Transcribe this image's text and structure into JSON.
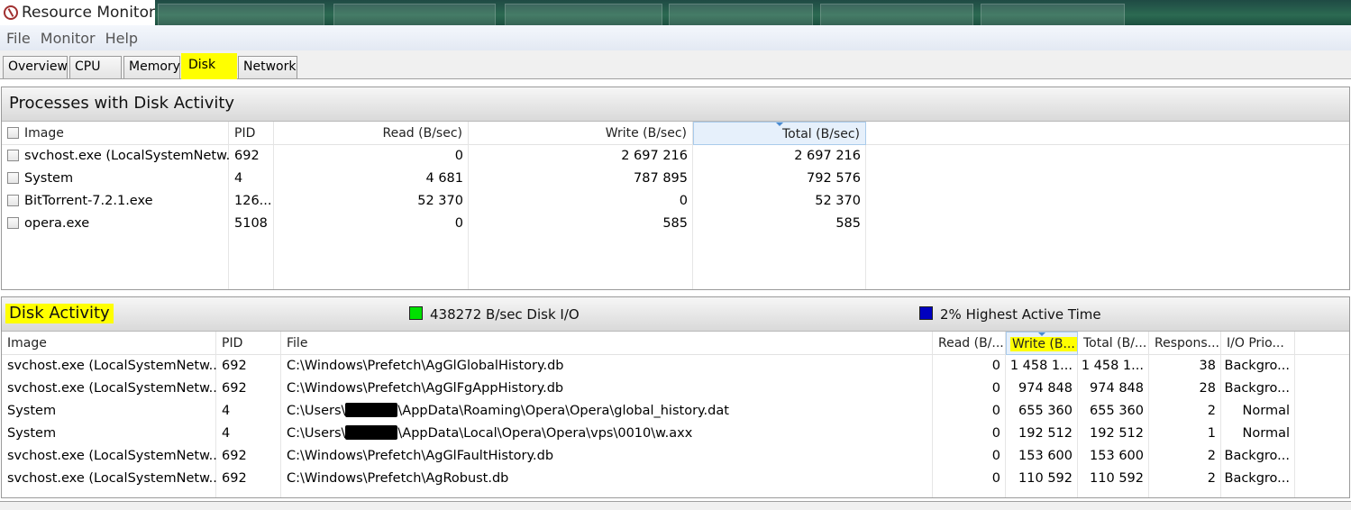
{
  "window": {
    "title": "Resource Monitor"
  },
  "menu": [
    "File",
    "Monitor",
    "Help"
  ],
  "tabs": [
    "Overview",
    "CPU",
    "Memory",
    "Disk",
    "Network"
  ],
  "highlight_color": "#ffff00",
  "processes": {
    "title": "Processes with Disk Activity",
    "columns": [
      "Image",
      "PID",
      "Read (B/sec)",
      "Write (B/sec)",
      "Total (B/sec)"
    ],
    "rows": [
      {
        "image": "svchost.exe (LocalSystemNetw...",
        "pid": "692",
        "read": "0",
        "write": "2 697 216",
        "total": "2 697 216"
      },
      {
        "image": "System",
        "pid": "4",
        "read": "4 681",
        "write": "787 895",
        "total": "792 576"
      },
      {
        "image": "BitTorrent-7.2.1.exe",
        "pid": "126...",
        "read": "52 370",
        "write": "0",
        "total": "52 370"
      },
      {
        "image": "opera.exe",
        "pid": "5108",
        "read": "0",
        "write": "585",
        "total": "585"
      }
    ]
  },
  "disk_activity": {
    "title": "Disk Activity",
    "io_label": "438272 B/sec Disk I/O",
    "io_color": "#00e000",
    "active_label": "2% Highest Active Time",
    "active_color": "#0000c0",
    "columns": [
      "Image",
      "PID",
      "File",
      "Read (B/...",
      "Write (B...",
      "Total (B/...",
      "Respons...",
      "I/O Prio..."
    ],
    "rows": [
      {
        "image": "svchost.exe (LocalSystemNetw...",
        "pid": "692",
        "file_pre": "C:\\Windows\\Prefetch\\AgGlGlobalHistory.db",
        "file_post": "",
        "redacted": false,
        "read": "0",
        "write": "1 458 1...",
        "total": "1 458 1...",
        "resp": "38",
        "prio": "Backgro..."
      },
      {
        "image": "svchost.exe (LocalSystemNetw...",
        "pid": "692",
        "file_pre": "C:\\Windows\\Prefetch\\AgGlFgAppHistory.db",
        "file_post": "",
        "redacted": false,
        "read": "0",
        "write": "974 848",
        "total": "974 848",
        "resp": "28",
        "prio": "Backgro..."
      },
      {
        "image": "System",
        "pid": "4",
        "file_pre": "C:\\Users\\",
        "file_post": "\\AppData\\Roaming\\Opera\\Opera\\global_history.dat",
        "redacted": true,
        "read": "0",
        "write": "655 360",
        "total": "655 360",
        "resp": "2",
        "prio": "Normal"
      },
      {
        "image": "System",
        "pid": "4",
        "file_pre": "C:\\Users\\",
        "file_post": "\\AppData\\Local\\Opera\\Opera\\vps\\0010\\w.axx",
        "redacted": true,
        "read": "0",
        "write": "192 512",
        "total": "192 512",
        "resp": "1",
        "prio": "Normal"
      },
      {
        "image": "svchost.exe (LocalSystemNetw...",
        "pid": "692",
        "file_pre": "C:\\Windows\\Prefetch\\AgGlFaultHistory.db",
        "file_post": "",
        "redacted": false,
        "read": "0",
        "write": "153 600",
        "total": "153 600",
        "resp": "2",
        "prio": "Backgro..."
      },
      {
        "image": "svchost.exe (LocalSystemNetw...",
        "pid": "692",
        "file_pre": "C:\\Windows\\Prefetch\\AgRobust.db",
        "file_post": "",
        "redacted": false,
        "read": "0",
        "write": "110 592",
        "total": "110 592",
        "resp": "2",
        "prio": "Backgro..."
      }
    ]
  }
}
